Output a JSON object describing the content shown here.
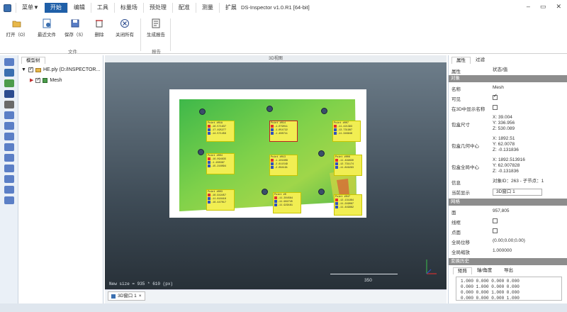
{
  "window": {
    "title": "DS-Inspector v1.0.R1 [64-bit]",
    "controls": [
      "–",
      "▭",
      "✕"
    ]
  },
  "menu": [
    "菜单▼",
    "开始",
    "编辑",
    "工具",
    "标量场",
    "预处理",
    "配准",
    "测量",
    "扩展"
  ],
  "ribbon": {
    "buttons": [
      {
        "label": "打开（O）",
        "icon": "open-folder-icon"
      },
      {
        "label": "最近文件",
        "icon": "recent-files-icon"
      },
      {
        "label": "保存（S）",
        "icon": "save-icon"
      },
      {
        "label": "删除",
        "icon": "delete-icon"
      },
      {
        "label": "关闭所有",
        "icon": "close-all-icon"
      },
      {
        "label": "生成报告",
        "icon": "report-icon"
      }
    ],
    "groups": [
      "文件",
      "报告"
    ]
  },
  "model_tree": {
    "tab": "模型树",
    "root": "HE.ply (D:/INSPECTOR...",
    "child": "Mesh"
  },
  "view": {
    "header": "3D视图",
    "new_size": "New size = 935 * 610 (px)",
    "scale_value": "350",
    "tab_label": "3D窗口 1",
    "annotations": [
      {
        "title": "Point #01A",
        "vals": [
          "-16.571937",
          "-17.495277",
          "-14.571456"
        ]
      },
      {
        "title": "Point #014",
        "vals": [
          "-1.079011",
          "-1.054722",
          "-1.408711"
        ]
      },
      {
        "title": "Point #007",
        "vals": [
          "-11.421393",
          "-13.731987",
          "-11.346948"
        ]
      },
      {
        "title": "Point #004",
        "vals": [
          "-16.094635",
          "-1.108387",
          "-15.216094"
        ]
      },
      {
        "title": "Point #013",
        "vals": [
          "-1.101608",
          "-2.611549",
          "-2.094191"
        ]
      },
      {
        "title": "Point #006",
        "vals": [
          "-11.499830",
          "-12.731174",
          "-11.849293"
        ]
      },
      {
        "title": "Point #003",
        "vals": [
          "-16.919457",
          "-11.618418",
          "-16.447017"
        ]
      },
      {
        "title": "Point #0",
        "vals": [
          "-11.304564",
          "-11.962745",
          "-11.929161"
        ]
      },
      {
        "title": "Point #047",
        "vals": [
          "-12.131984",
          "-11.249087",
          "-11.449982"
        ]
      }
    ]
  },
  "properties": {
    "tabs": [
      "属性",
      "过滤"
    ],
    "header": {
      "k": "属性",
      "v": "状态/值"
    },
    "sections": [
      "对象",
      "网格",
      "变换历史"
    ],
    "rows": [
      {
        "k": "名称",
        "v": "Mesh"
      },
      {
        "k": "可见",
        "v": "checked"
      },
      {
        "k": "在3D中显示名称",
        "v": "unchecked"
      },
      {
        "k": "包盒尺寸",
        "v": "X: 39.004\nY: 336.956\nZ: 530.089"
      },
      {
        "k": "包盒几何中心",
        "v": "X: 1892.51\nY: 62.0078\nZ: -0.131836"
      },
      {
        "k": "包盒全局中心",
        "v": "X: 1892.513916\nY: 62.007828\nZ: -0.131836"
      },
      {
        "k": "信息",
        "v": "对象ID：263 - 子节点：1"
      },
      {
        "k": "当前显示",
        "v": "3D窗口 1"
      }
    ],
    "mesh_rows": [
      {
        "k": "面",
        "v": "957,805"
      },
      {
        "k": "线框",
        "v": "unchecked"
      },
      {
        "k": "点面",
        "v": "unchecked"
      },
      {
        "k": "全局位移",
        "v": "(0.00;0.00;0.00)"
      },
      {
        "k": "全局缩放",
        "v": "1.000000"
      }
    ],
    "history_tabs": [
      "矩阵",
      "轴/角度",
      "导出"
    ],
    "matrix": [
      "1.000 0.000 0.000 0.000",
      "0.000 1.000 0.000 0.000",
      "0.000 0.000 1.000 0.000",
      "0.000 0.000 0.000 1.000"
    ]
  }
}
